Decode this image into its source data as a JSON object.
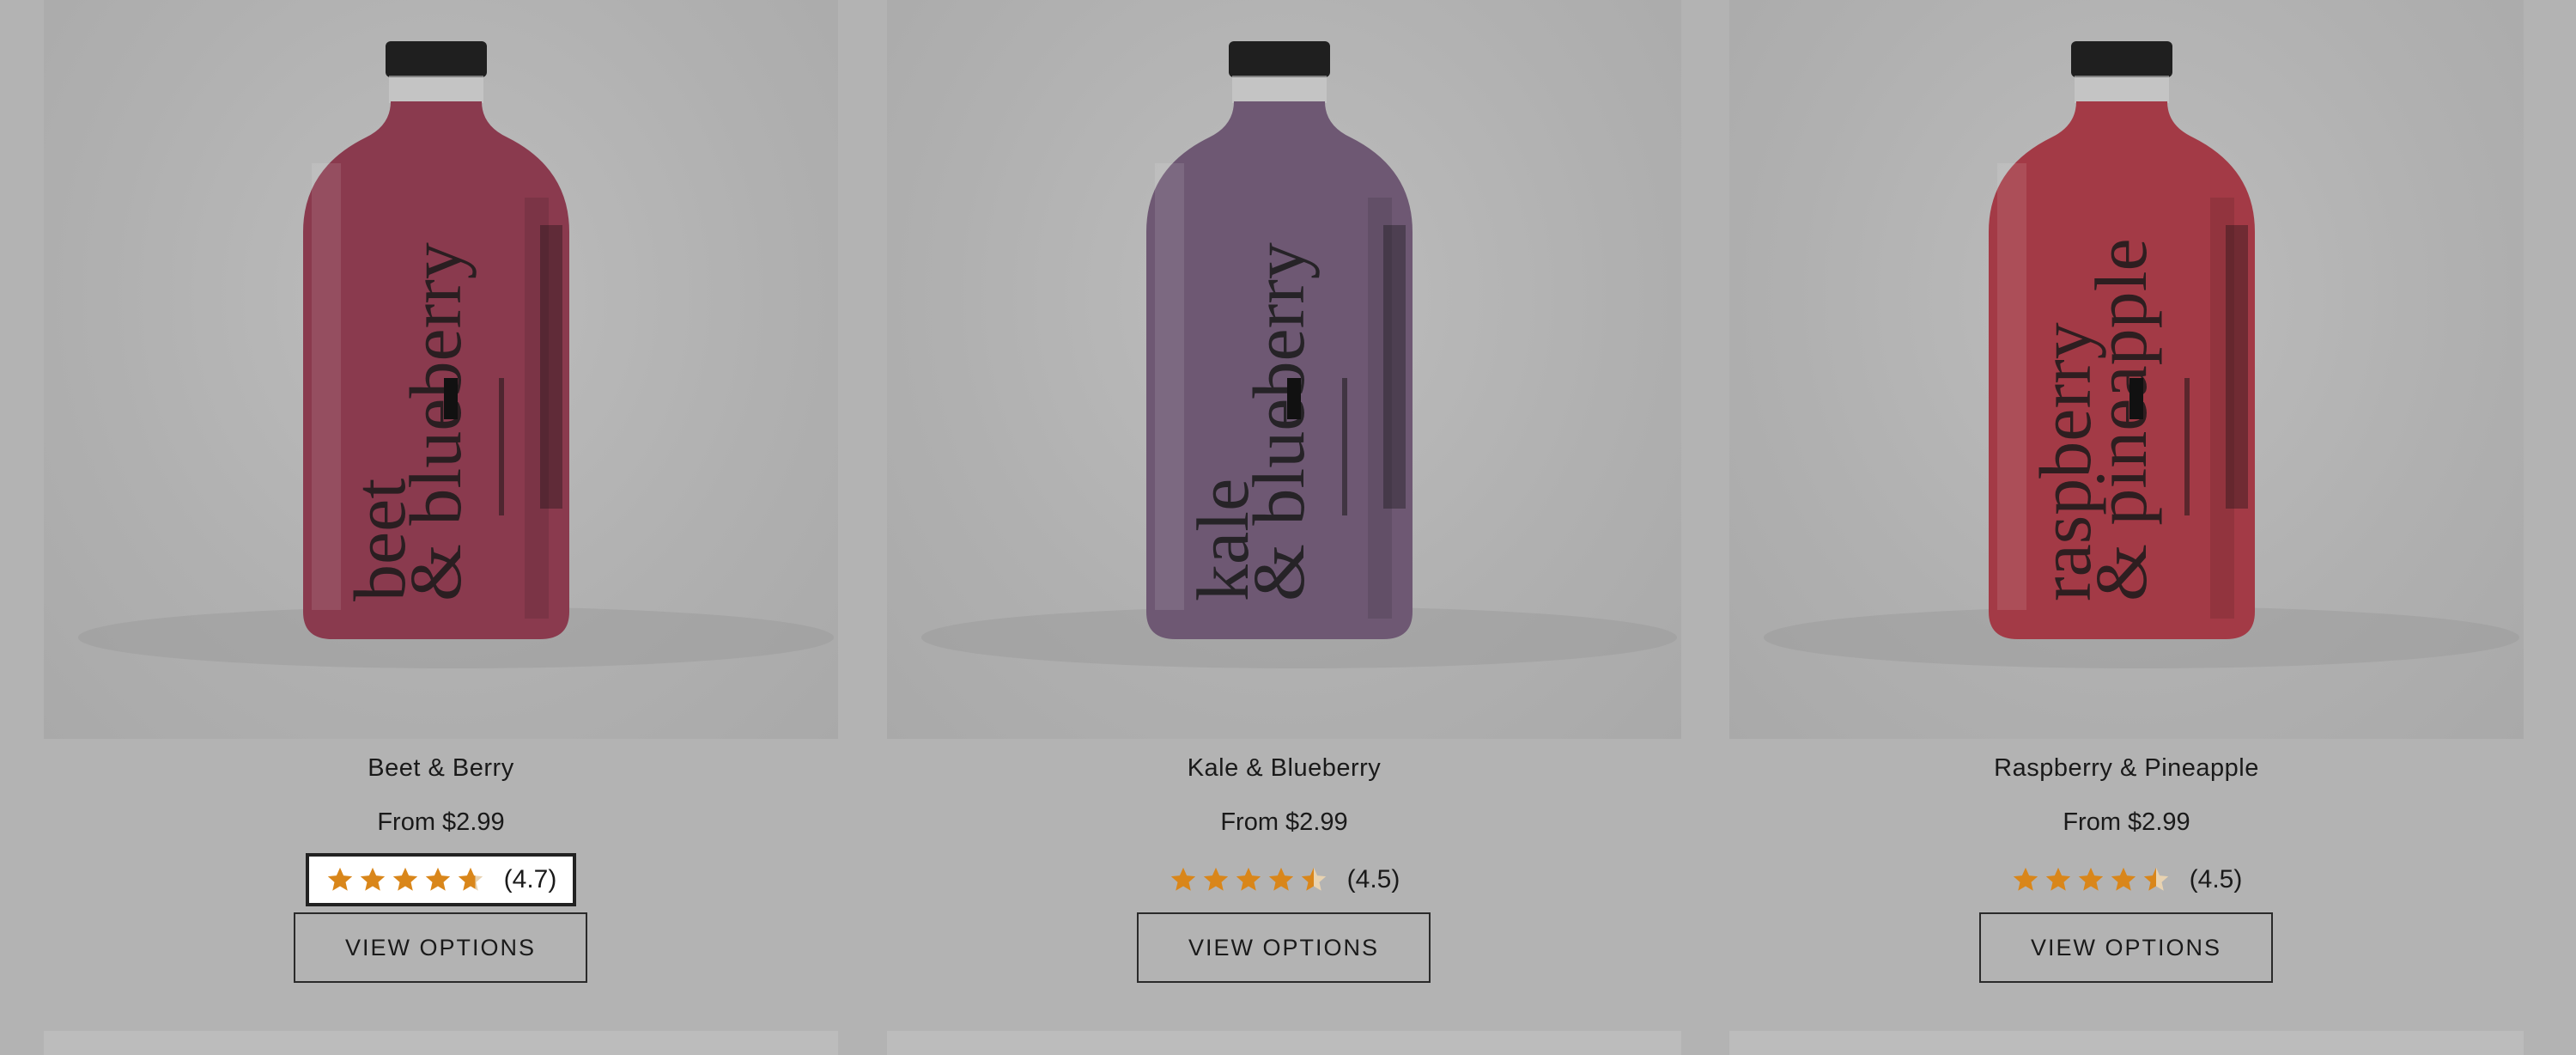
{
  "products": [
    {
      "name": "Beet & Berry",
      "price": "From $2.99",
      "rating_value": 4.7,
      "rating_text": "(4.7)",
      "button_label": "VIEW OPTIONS",
      "label_line1": "beet",
      "label_line2": "& blueberry",
      "bottle_color": "#8a3a4e",
      "bottle_shade": "#6a2638"
    },
    {
      "name": "Kale & Blueberry",
      "price": "From $2.99",
      "rating_value": 4.5,
      "rating_text": "(4.5)",
      "button_label": "VIEW OPTIONS",
      "label_line1": "kale",
      "label_line2": "& blueberry",
      "bottle_color": "#6e5873",
      "bottle_shade": "#4f3d55"
    },
    {
      "name": "Raspberry & Pineapple",
      "price": "From $2.99",
      "rating_value": 4.5,
      "rating_text": "(4.5)",
      "button_label": "VIEW OPTIONS",
      "label_line1": "raspberry",
      "label_line2": "& pineapple",
      "bottle_color": "#a33a46",
      "bottle_shade": "#7d2531"
    }
  ],
  "colors": {
    "star_fill": "#d9861a",
    "star_empty": "#e8d2b0",
    "background": "#b3b3b3"
  },
  "icons": {
    "star": "star-icon",
    "half_star": "star-half-icon"
  }
}
